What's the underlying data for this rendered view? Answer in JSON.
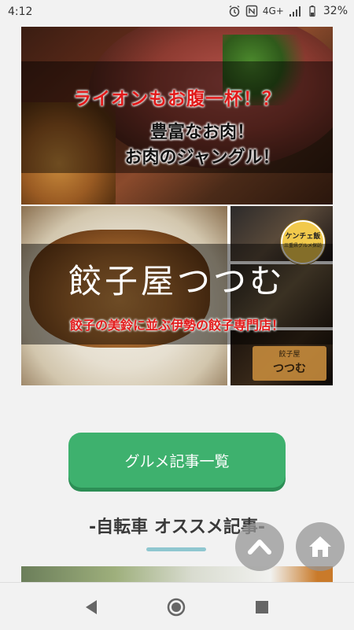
{
  "status_bar": {
    "time": "4:12",
    "network": "4G+",
    "battery": "32%"
  },
  "banner_lion": {
    "headline": "ライオンもお腹一杯！？",
    "line1": "豊富なお肉！",
    "line2": "お肉のジャングル！"
  },
  "banner_gyoza": {
    "title": "餃子屋つつむ",
    "catchphrase": "餃子の美鈴に並ぶ伊勢の餃子専門店！",
    "badge_line1": "ケンチェ飯",
    "badge_line2": "三重県グルメ探訪",
    "sign_line1": "餃子屋",
    "sign_line2": "つつむ"
  },
  "cta_button_label": "グルメ記事一覧",
  "section_title": "-自転車 オススメ記事-",
  "colors": {
    "accent_green": "#3eb16e",
    "headline_red": "#e21b1b",
    "underline_teal": "#8fc7d0"
  },
  "icons": {
    "scroll_top": "chevron-up-icon",
    "home": "home-icon",
    "nav_back": "back-triangle-icon",
    "nav_home": "circle-home-icon",
    "nav_recents": "square-recents-icon"
  }
}
